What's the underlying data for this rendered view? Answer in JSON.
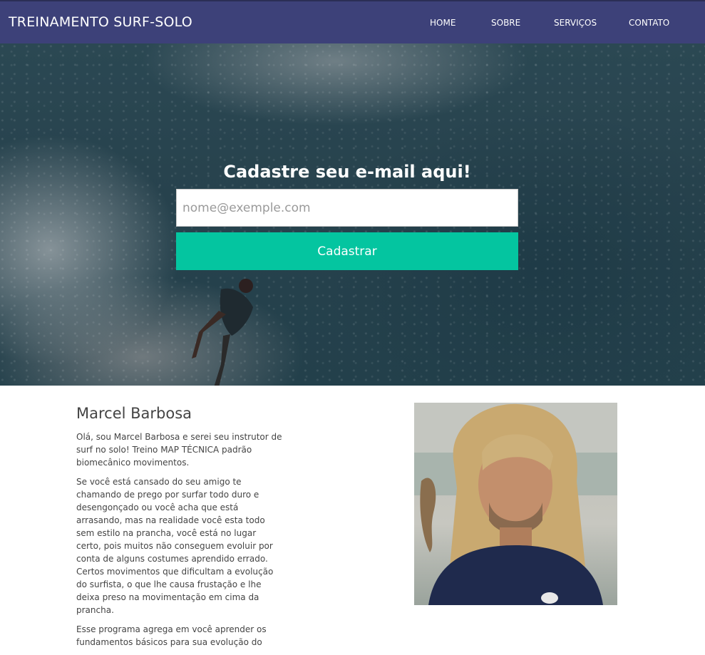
{
  "navbar": {
    "brand": "TREINAMENTO SURF-SOLO",
    "links": [
      "HOME",
      "SOBRE",
      "SERVIÇOS",
      "CONTATO"
    ],
    "background": "#3d4179"
  },
  "hero": {
    "title": "Cadastre seu e-mail aqui!",
    "email_placeholder": "nome@exemple.com",
    "email_value": "",
    "submit_label": "Cadastrar",
    "accent": "#04c5a0"
  },
  "about": {
    "name": "Marcel Barbosa",
    "paragraphs": [
      "Olá, sou Marcel Barbosa e serei seu instrutor de surf no solo! Treino MAP TÉCNICA padrão biomecânico movimentos.",
      "Se você está cansado do seu amigo te chamando de prego por surfar todo duro e desengonçado ou você acha que está arrasando, mas na realidade você esta todo sem estilo na prancha, você está no lugar certo, pois muitos não conseguem evoluir por conta de alguns costumes aprendido errado. Certos movimentos que dificultam a evolução do surfista, o que lhe causa frustação e lhe deixa preso na movimentação em cima da prancha.",
      "Esse programa agrega em você aprender os fundamentos básicos para sua evolução do"
    ],
    "photo_icon": "instructor-portrait"
  }
}
